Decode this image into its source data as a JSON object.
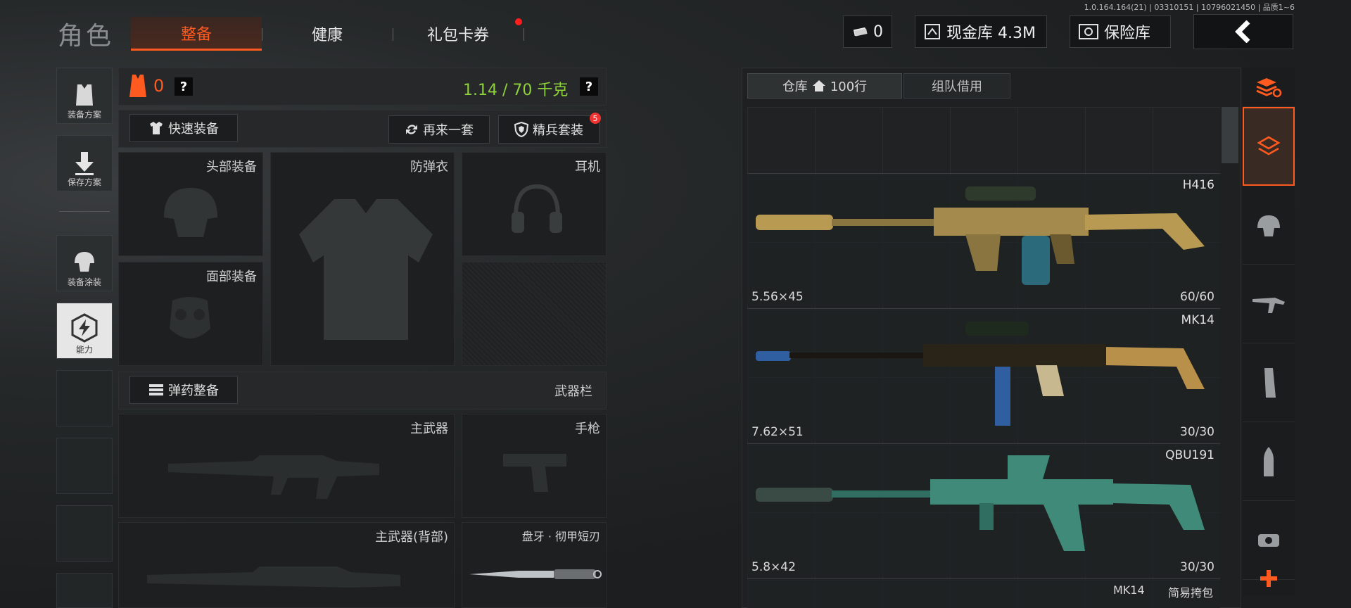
{
  "build_info": "1.0.164.164(21) | 03310151 | 10796021450 | 品质1~6",
  "page_title": "角色",
  "tabs": [
    {
      "label": "整备",
      "active": true
    },
    {
      "label": "健康",
      "active": false
    },
    {
      "label": "礼包卡券",
      "active": false
    }
  ],
  "currency": {
    "ticket_count": "0",
    "cash_label": "现金库 4.3M",
    "vault_label": "保险库"
  },
  "sidebar": {
    "items": [
      {
        "label": "装备方案"
      },
      {
        "label": "保存方案"
      },
      {
        "label": "装备涂装"
      },
      {
        "label": "能力"
      }
    ]
  },
  "equipment": {
    "armor_count": "0",
    "weight": "1.14 / 70 千克",
    "quick_equip": "快速装备",
    "another_set": "再来一套",
    "elite_set": "精兵套装",
    "elite_badge": "5",
    "slots": {
      "head": "头部装备",
      "vest": "防弹衣",
      "headset": "耳机",
      "face": "面部装备"
    },
    "ammo_equip": "弹药整备",
    "weapon_bar": "武器栏",
    "weapon_slots": {
      "primary": "主武器",
      "pistol": "手枪",
      "primary_back": "主武器(背部)",
      "melee": "盘牙 · 彻甲短刃"
    }
  },
  "warehouse": {
    "tab_storage": "仓库",
    "rows": "100行",
    "tab_team": "组队借用",
    "items": [
      {
        "name": "H416",
        "caliber": "5.56×45",
        "ammo": "60/60",
        "color": "#a48a4c"
      },
      {
        "name": "MK14",
        "caliber": "7.62×51",
        "ammo": "30/30",
        "color": "#2a2418"
      },
      {
        "name": "QBU191",
        "caliber": "5.8×42",
        "ammo": "30/30",
        "color": "#3f8a78"
      }
    ],
    "partial_item": {
      "name": "MK14",
      "tag": "简易挎包"
    }
  },
  "colors": {
    "accent": "#ff5a1f",
    "weight_green": "#8ed23a"
  }
}
